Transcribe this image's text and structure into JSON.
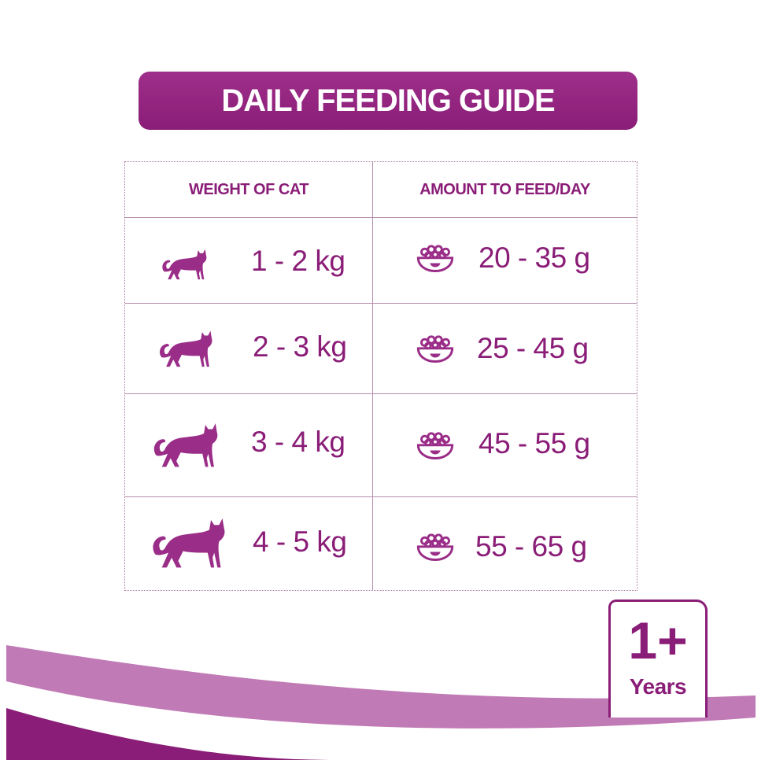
{
  "title": "DAILY FEEDING GUIDE",
  "table": {
    "header_weight": "WEIGHT OF CAT",
    "header_amount": "AMOUNT TO FEED/DAY",
    "rows": [
      {
        "weight": "1 - 2 kg",
        "amount": "20 - 35 g"
      },
      {
        "weight": "2 - 3 kg",
        "amount": "25 - 45 g"
      },
      {
        "weight": "3 - 4 kg",
        "amount": "45 - 55 g"
      },
      {
        "weight": "4 - 5 kg",
        "amount": "55 - 65 g"
      }
    ]
  },
  "badge": {
    "big": "1+",
    "small": "Years"
  },
  "colors": {
    "brand_purple": "#8a1d77",
    "light_purple": "#c07ab5"
  },
  "icons": [
    "cat-silhouette-icon",
    "food-bowl-icon"
  ]
}
